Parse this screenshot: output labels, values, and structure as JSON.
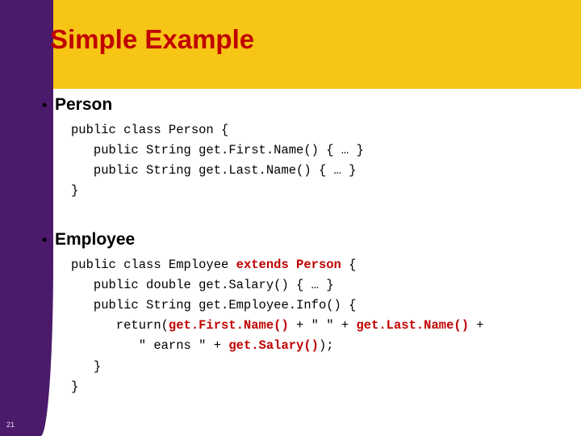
{
  "slide": {
    "title": "Simple Example",
    "slide_number": "21",
    "colors": {
      "header_band": "#f6c516",
      "left_band": "#4b1a6b",
      "title_text": "#c00000",
      "body_text": "#000000",
      "highlight": "#c00000"
    },
    "bullets": [
      {
        "marker": "•",
        "label": "Person",
        "code_lines": [
          "public class Person {",
          "   public String get.First.Name() { … }",
          "   public String get.Last.Name() { … }",
          "}"
        ]
      },
      {
        "marker": "•",
        "label": "Employee",
        "code_lines": [
          "public class Employee ",
          "extends Person",
          " {",
          "   public double get.Salary() { … }",
          "",
          "   public String get.Employee.Info() {",
          "      return(",
          "get.First.Name()",
          " + \" \" + ",
          "get.Last.Name()",
          " +",
          "         \" earns \" + ",
          "get.Salary()",
          ");",
          "   }",
          "}"
        ]
      }
    ]
  }
}
